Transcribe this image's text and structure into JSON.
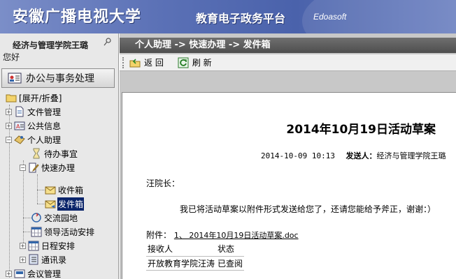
{
  "banner": {
    "university": "安徽广播电视大学",
    "platform": "教育电子政务平台",
    "brand": "Edoasoft"
  },
  "sidebar": {
    "user_name": "经济与管理学院王璐",
    "greeting": "您好",
    "section_label": "办公与事务处理",
    "tree": {
      "expand_collapse": "[展开/折叠]",
      "file_mgmt": "文件管理",
      "public_info": "公共信息",
      "personal_assistant": "个人助理",
      "todo": "待办事宜",
      "quick_office": "快速办理",
      "inbox": "收件箱",
      "outbox": "发件箱",
      "exchange": "交流园地",
      "leader_schedule": "领导活动安排",
      "schedule": "日程安排",
      "contacts": "通讯录",
      "meeting_mgmt": "会议管理"
    }
  },
  "main": {
    "breadcrumb": "个人助理 -> 快速办理 -> 发件箱",
    "toolbar": {
      "back": "返 回",
      "refresh": "刷 新"
    },
    "doc": {
      "title": "2014年10月19日活动草案",
      "datetime": "2014-10-09 10:13",
      "sender_label": "发送人：",
      "sender": "经济与管理学院王璐",
      "salutation": "汪院长：",
      "body": "我已将活动草案以附件形式发送给您了，还请您能给予斧正，谢谢：）",
      "attach_label": "附件：",
      "attachment": "1、 2014年10月19日活动草案.doc",
      "recipients_header": {
        "recipient": "接收人",
        "status": "状态"
      },
      "recipients": [
        {
          "name": "开放教育学院汪涛",
          "status": "已查阅"
        }
      ]
    }
  }
}
